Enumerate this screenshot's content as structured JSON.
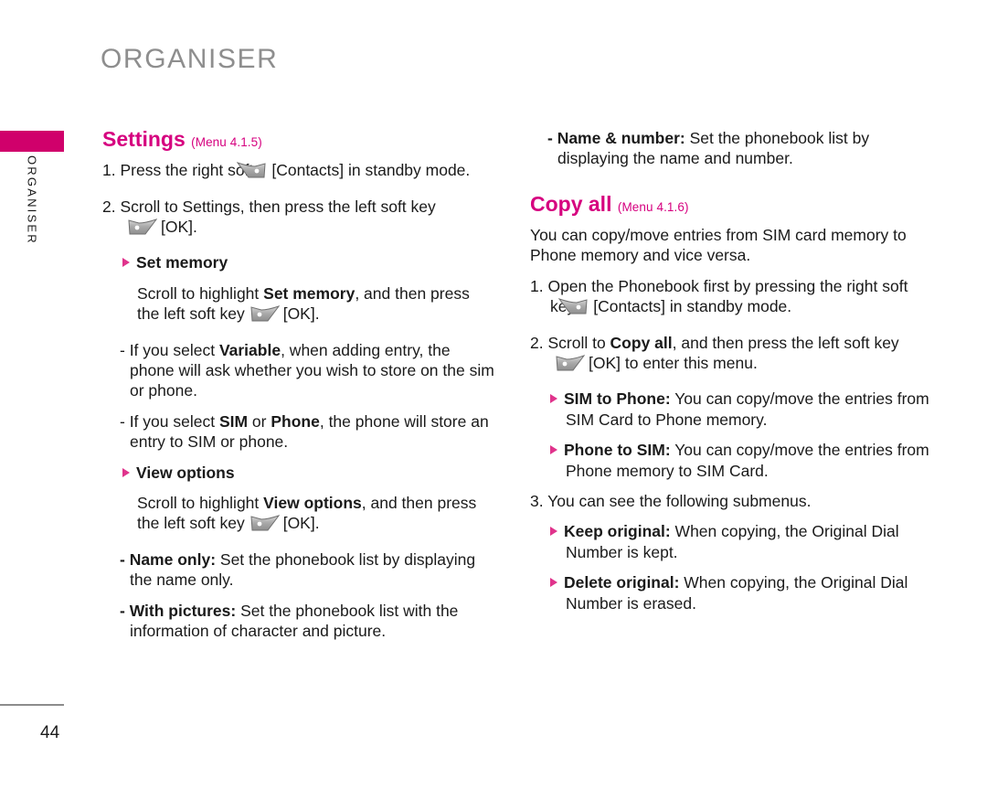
{
  "page": {
    "chapter_title": "ORGANISER",
    "side_tab_label": "ORGANISER",
    "page_number": "44",
    "accent_color": "#d6007f",
    "tab_color": "#d0006b",
    "title_color": "#8e8e8e"
  },
  "icons": {
    "right_soft_key": "right-soft-key-icon",
    "left_soft_key": "left-soft-key-icon",
    "bullet": "pink-triangle-bullet-icon"
  },
  "left_column": {
    "heading": {
      "title": "Settings",
      "menu_ref": "(Menu 4.1.5)"
    },
    "step1_a": "1. Press the right soft",
    "step1_b": "[Contacts] in standby mode.",
    "step2_a": "2. Scroll to Settings, then press the left soft key",
    "step2_b": "[OK].",
    "set_memory": {
      "heading": "Set memory",
      "intro_a": "Scroll to highlight ",
      "intro_bold": "Set memory",
      "intro_b": ", and then press the left soft key",
      "intro_c": "[OK].",
      "items": [
        {
          "bold": "Variable",
          "pre": "- If you select ",
          "post": ", when adding entry, the phone will ask whether you wish to store on the sim or phone."
        },
        {
          "pre": "- If you select ",
          "bold": "SIM",
          "mid": " or ",
          "bold2": "Phone",
          "post": ", the phone will store an entry to SIM or phone."
        }
      ]
    },
    "view_options": {
      "heading": "View options",
      "intro_a": "Scroll to highlight ",
      "intro_bold": "View options",
      "intro_b": ", and then press the left soft key",
      "intro_c": "[OK].",
      "items": [
        {
          "bold": "- Name only:",
          "text": " Set the phonebook list by displaying the name only."
        },
        {
          "bold": "- With pictures:",
          "text": " Set the phonebook list with the information of character and picture."
        }
      ]
    }
  },
  "right_column": {
    "name_and_number": {
      "bold": "- Name & number:",
      "text": " Set the phonebook list by displaying the name and number."
    },
    "heading": {
      "title": "Copy all",
      "menu_ref": "(Menu 4.1.6)"
    },
    "intro": "You can copy/move entries from SIM card memory to Phone memory and vice versa.",
    "step1_a": "1. Open the Phonebook first by pressing the right soft key",
    "step1_b": "[Contacts] in standby mode.",
    "step2_a": "2. Scroll to ",
    "step2_bold": "Copy all",
    "step2_b": ", and then press the left soft key",
    "step2_c": "[OK] to enter this menu.",
    "bullets_a": [
      {
        "bold": "SIM to Phone:",
        "text": " You can copy/move the entries from SIM Card to Phone memory."
      },
      {
        "bold": "Phone to SIM:",
        "text": " You can copy/move the entries from Phone memory to SIM Card."
      }
    ],
    "step3": "3. You can see the following submenus.",
    "bullets_b": [
      {
        "bold": "Keep original:",
        "text": " When copying, the Original Dial Number is kept."
      },
      {
        "bold": "Delete original:",
        "text": " When copying, the Original Dial Number is erased."
      }
    ]
  }
}
